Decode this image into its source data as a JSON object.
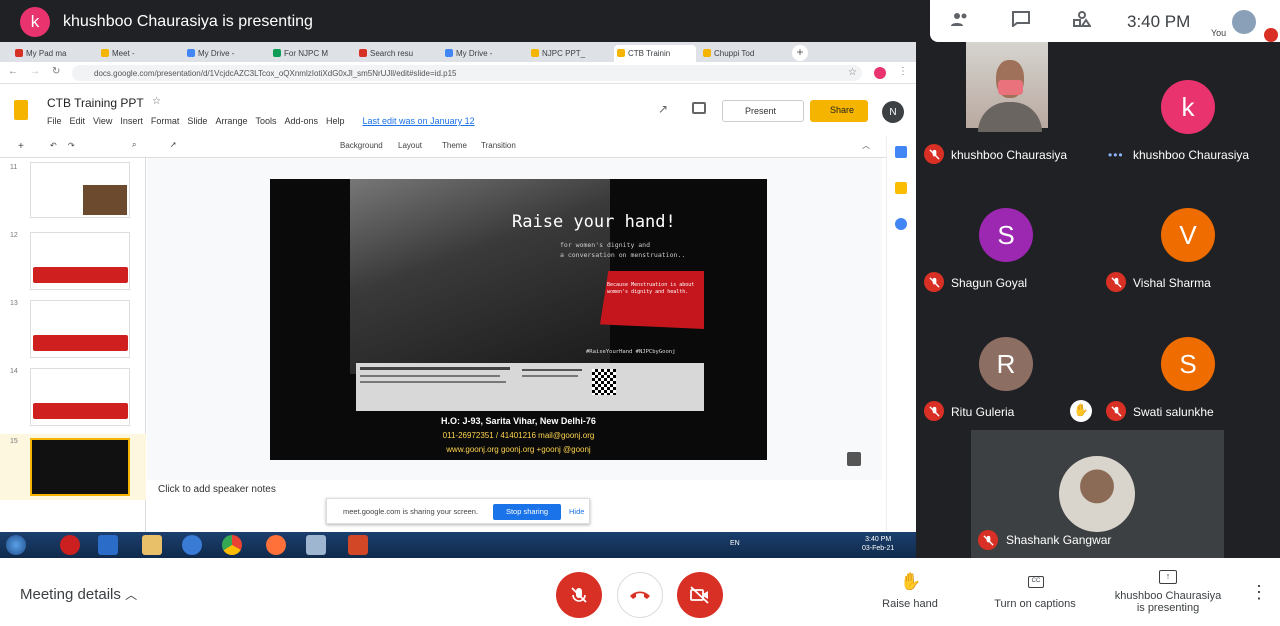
{
  "top_bar": {
    "presenter_initial": "k",
    "title": "khushboo Chaurasiya is presenting"
  },
  "meet_info": {
    "clock": "3:40 PM",
    "you_label": "You"
  },
  "browser": {
    "tabs": [
      "My Pad ma",
      "Meet -",
      "My Drive -",
      "For NJPC M",
      "Search resu",
      "My Drive -",
      "NJPC PPT_",
      "CTB Trainin",
      "Chuppi Tod"
    ],
    "url": "docs.google.com/presentation/d/1VcjdcAZC3LTcox_oQXnmlzIotiXdG0xJl_sm5NrUJll/edit#slide=id.p15"
  },
  "slides_app": {
    "doc_title": "CTB Training PPT",
    "menu": [
      "File",
      "Edit",
      "View",
      "Insert",
      "Format",
      "Slide",
      "Arrange",
      "Tools",
      "Add-ons",
      "Help"
    ],
    "last_edit": "Last edit was on January 12",
    "present_label": "Present",
    "share_label": "Share",
    "user_initial": "N",
    "toolbar": [
      "Background",
      "Layout",
      "Theme",
      "Transition"
    ],
    "thumbnail_numbers": [
      "11",
      "12",
      "13",
      "14",
      "15"
    ],
    "speaker_notes": "Click to add speaker notes"
  },
  "slide": {
    "headline": "Raise your hand!",
    "sub": "for women's dignity and\na conversation on menstruation..",
    "ribbon": "Because Menstruation is about\nwomen's dignity and health.",
    "hashtag": "#RaiseYourHand  #NJPCbyGoonj",
    "ho": "H.O: J-93, Sarita Vihar, New Delhi-76",
    "contact1": "011-26972351 / 41401216     mail@goonj.org",
    "contact2": "www.goonj.org    goonj.org    +goonj    @goonj"
  },
  "sharing_bar": {
    "text": "meet.google.com is sharing your screen.",
    "stop": "Stop sharing",
    "hide": "Hide"
  },
  "taskbar": {
    "time": "3:40 PM",
    "date": "03-Feb-21",
    "lang": "EN"
  },
  "participants": [
    {
      "name": "khushboo Chaurasiya",
      "initial": "",
      "color": ""
    },
    {
      "name": "khushboo Chaurasiya",
      "initial": "k",
      "color": "#e8336e"
    },
    {
      "name": "Shagun Goyal",
      "initial": "S",
      "color": "#9c27b0"
    },
    {
      "name": "Vishal Sharma",
      "initial": "V",
      "color": "#ef6c00"
    },
    {
      "name": "Ritu Guleria",
      "initial": "R",
      "color": "#8d6e63"
    },
    {
      "name": "Swati salunkhe",
      "initial": "S",
      "color": "#ef6c00"
    },
    {
      "name": "Shashank Gangwar",
      "initial": "",
      "color": ""
    }
  ],
  "bottom_bar": {
    "meeting_details": "Meeting details",
    "raise_hand": "Raise hand",
    "captions": "Turn on captions",
    "presenting_line1": "khushboo Chaurasiya",
    "presenting_line2": "is presenting"
  }
}
